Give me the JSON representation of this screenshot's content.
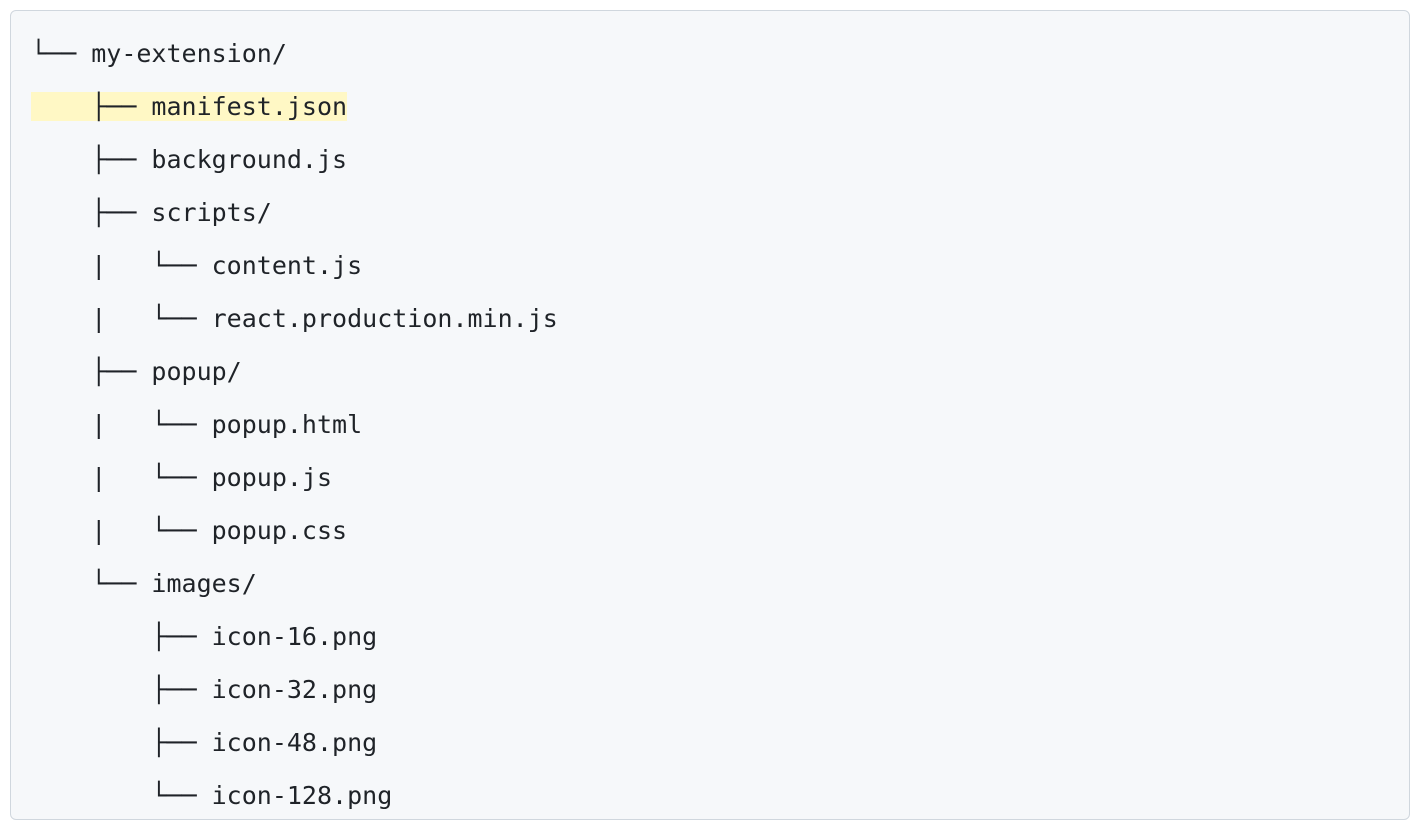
{
  "tree": {
    "lines": [
      {
        "prefix": "└── ",
        "name": "my-extension/",
        "highlighted": false
      },
      {
        "prefix": "    ├── ",
        "name": "manifest.json",
        "highlighted": true
      },
      {
        "prefix": "    ├── ",
        "name": "background.js",
        "highlighted": false
      },
      {
        "prefix": "    ├── ",
        "name": "scripts/",
        "highlighted": false
      },
      {
        "prefix": "    |   └── ",
        "name": "content.js",
        "highlighted": false
      },
      {
        "prefix": "    |   └── ",
        "name": "react.production.min.js",
        "highlighted": false
      },
      {
        "prefix": "    ├── ",
        "name": "popup/",
        "highlighted": false
      },
      {
        "prefix": "    |   └── ",
        "name": "popup.html",
        "highlighted": false
      },
      {
        "prefix": "    |   └── ",
        "name": "popup.js",
        "highlighted": false
      },
      {
        "prefix": "    |   └── ",
        "name": "popup.css",
        "highlighted": false
      },
      {
        "prefix": "    └── ",
        "name": "images/",
        "highlighted": false
      },
      {
        "prefix": "        ├── ",
        "name": "icon-16.png",
        "highlighted": false
      },
      {
        "prefix": "        ├── ",
        "name": "icon-32.png",
        "highlighted": false
      },
      {
        "prefix": "        ├── ",
        "name": "icon-48.png",
        "highlighted": false
      },
      {
        "prefix": "        └── ",
        "name": "icon-128.png",
        "highlighted": false
      }
    ]
  }
}
